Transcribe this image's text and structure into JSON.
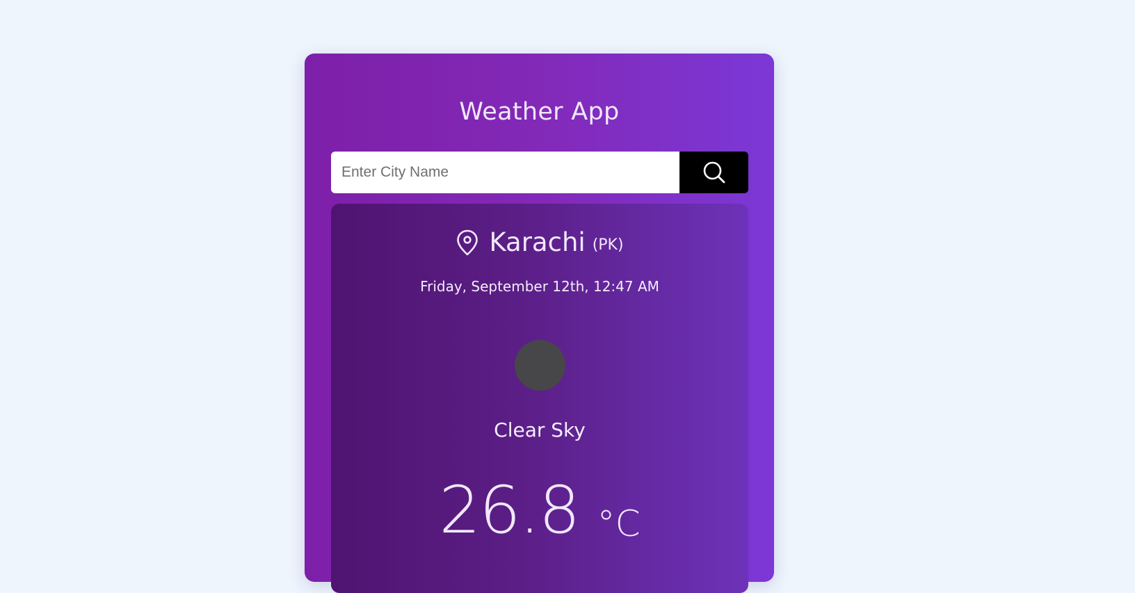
{
  "app": {
    "title": "Weather App"
  },
  "search": {
    "placeholder": "Enter City Name",
    "value": "",
    "button_icon": "search-icon"
  },
  "weather": {
    "location_icon": "map-pin-icon",
    "city": "Karachi",
    "country": "(PK)",
    "datetime": "Friday, September 12th, 12:47 AM",
    "condition": "Clear Sky",
    "temperature": "26.8",
    "unit": "°C"
  },
  "colors": {
    "page_background": "#eef5fd",
    "card_gradient_start": "#7d1fa8",
    "card_gradient_end": "#7b38d6",
    "panel_gradient_start": "#4f1470",
    "panel_gradient_end": "#6d32b9",
    "search_button": "#000000",
    "weather_icon_placeholder": "#474649"
  }
}
